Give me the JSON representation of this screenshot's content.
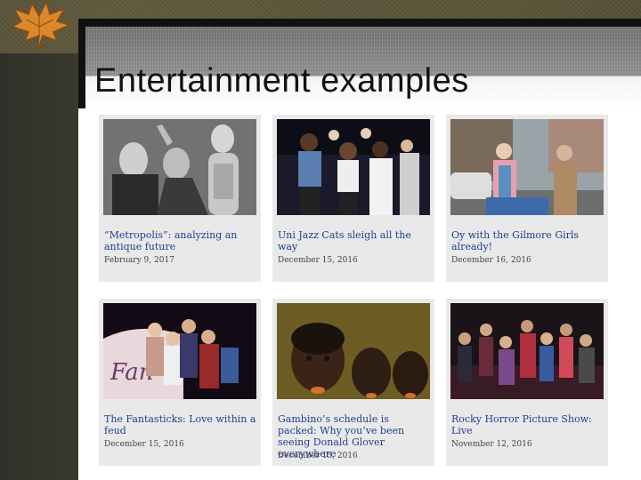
{
  "slide": {
    "title": "Entertainment examples"
  },
  "articles": [
    {
      "title": "“Metropolis”: analyzing an antique future",
      "date": "February 9, 2017",
      "image": "black-and-white-film-still"
    },
    {
      "title": "Uni Jazz Cats sleigh all the way",
      "date": "December 15, 2016",
      "image": "singers-on-stage"
    },
    {
      "title": "Oy with the Gilmore Girls already!",
      "date": "December 16, 2016",
      "image": "two-women-on-street"
    },
    {
      "title": "The Fantasticks: Love within a feud",
      "date": "December 15, 2016",
      "image": "theater-cast"
    },
    {
      "title": "Gambino’s schedule is packed: Why you’ve been seeing Donald Glover everywhere",
      "date": "December 15, 2016",
      "image": "three-men-portrait"
    },
    {
      "title": "Rocky Horror Picture Show: Live",
      "date": "November 12, 2016",
      "image": "cast-group-photo"
    }
  ],
  "colors": {
    "headline": "#1f3f8f",
    "card_background": "#e9e9e9",
    "backdrop": "#3c3b2c"
  }
}
